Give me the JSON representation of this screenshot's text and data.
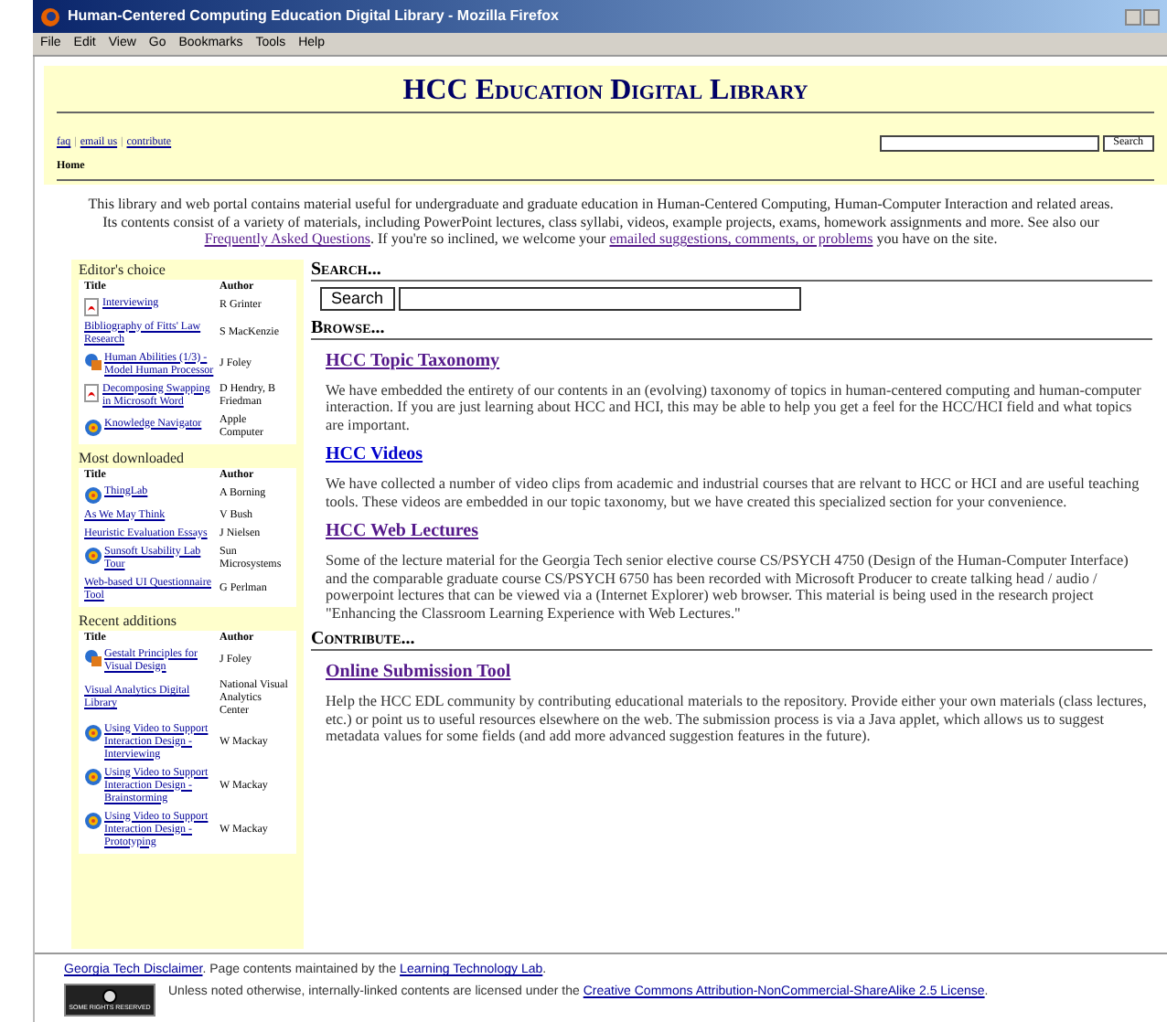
{
  "window": {
    "title": "Human-Centered Computing Education Digital Library - Mozilla Firefox"
  },
  "menu": [
    "File",
    "Edit",
    "View",
    "Go",
    "Bookmarks",
    "Tools",
    "Help"
  ],
  "header": {
    "title": "HCC Education Digital Library",
    "links": [
      {
        "kind": "link",
        "text": "faq"
      },
      {
        "kind": "separator",
        "text": "|"
      },
      {
        "kind": "link",
        "text": "email us"
      },
      {
        "kind": "separator",
        "text": "|"
      },
      {
        "kind": "link",
        "text": "contribute"
      }
    ],
    "search_button": "Search",
    "breadcrumb": "Home"
  },
  "intro": [
    {
      "kind": "text",
      "text": "This library and web portal contains material useful for undergraduate and graduate education in Human-Centered Computing, Human-Computer Interaction and related areas. Its contents consist of a variety of materials, including PowerPoint lectures, class syllabi, videos, example projects, exams, homework assignments and more. See also our "
    },
    {
      "kind": "link",
      "text": "Frequently Asked Questions"
    },
    {
      "kind": "text",
      "text": ". If you're so inclined, we welcome your "
    },
    {
      "kind": "link",
      "text": "emailed suggestions, comments, or problems"
    },
    {
      "kind": "text",
      "text": " you have on the site."
    }
  ],
  "sidebar": [
    {
      "title": "Editor's choice",
      "columns": [
        "Title",
        "Author"
      ],
      "items": [
        {
          "title": "Interviewing",
          "author": "R Grinter",
          "kind": "pdf"
        },
        {
          "title": "Bibliography of Fitts' Law Research",
          "author": "S MacKenzie",
          "kind": "none"
        },
        {
          "title": "Human Abilities (1/3) - Model Human Processor",
          "author": "J Foley",
          "kind": "slides"
        },
        {
          "title": "Decomposing Swapping in Microsoft Word",
          "author": "D Hendry, B Friedman",
          "kind": "pdf"
        },
        {
          "title": "Knowledge Navigator",
          "author": "Apple Computer",
          "kind": "video"
        }
      ]
    },
    {
      "title": "Most downloaded",
      "columns": [
        "Title",
        "Author"
      ],
      "items": [
        {
          "title": "ThingLab",
          "author": "A Borning",
          "kind": "video"
        },
        {
          "title": "As We May Think",
          "author": "V Bush",
          "kind": "none"
        },
        {
          "title": "Heuristic Evaluation Essays",
          "author": "J Nielsen",
          "kind": "none"
        },
        {
          "title": "Sunsoft Usability Lab Tour",
          "author": "Sun Microsystems",
          "kind": "video"
        },
        {
          "title": "Web-based UI Questionnaire Tool",
          "author": "G Perlman",
          "kind": "none"
        }
      ]
    },
    {
      "title": "Recent additions",
      "columns": [
        "Title",
        "Author"
      ],
      "items": [
        {
          "title": "Gestalt Principles for Visual Design",
          "author": "J Foley",
          "kind": "slides"
        },
        {
          "title": "Visual Analytics Digital Library",
          "author": "National Visual Analytics Center",
          "kind": "none"
        },
        {
          "title": "Using Video to Support Interaction Design - Interviewing",
          "author": "W Mackay",
          "kind": "video"
        },
        {
          "title": "Using Video to Support Interaction Design - Brainstorming",
          "author": "W Mackay",
          "kind": "video"
        },
        {
          "title": "Using Video to Support Interaction Design - Prototyping",
          "author": "W Mackay",
          "kind": "video"
        }
      ]
    }
  ],
  "search": {
    "heading": "Search...",
    "button": "Search"
  },
  "browse": {
    "heading": "Browse...",
    "entries": [
      {
        "title": "HCC Topic Taxonomy",
        "visited": true,
        "text": "We have embedded the entirety of our contents in an (evolving) taxonomy of topics in human-centered computing and human-computer interaction. If you are just learning about HCC and HCI, this may be able to help you get a feel for the HCC/HCI field and what topics are important."
      },
      {
        "title": "HCC Videos",
        "visited": false,
        "text": "We have collected a number of video clips from academic and industrial courses that are relvant to HCC or HCI and are useful teaching tools. These videos are embedded in our topic taxonomy, but we have created this specialized section for your convenience."
      },
      {
        "title": "HCC Web Lectures",
        "visited": true,
        "text": "Some of the lecture material for the Georgia Tech senior elective course CS/PSYCH 4750 (Design of the Human-Computer Interface) and the comparable graduate course CS/PSYCH 6750 has been recorded with Microsoft Producer to create talking head / audio / powerpoint lectures that can be viewed via a (Internet Explorer) web browser. This material is being used in the research project \"Enhancing the Classroom Learning Experience with Web Lectures.\""
      }
    ]
  },
  "contribute": {
    "heading": "Contribute...",
    "entries": [
      {
        "title": "Online Submission Tool",
        "visited": true,
        "text": "Help the HCC EDL community by contributing educational materials to the repository. Provide either your own materials (class lectures, etc.) or point us to useful resources elsewhere on the web. The submission process is via a Java applet, which allows us to suggest metadata values for some fields (and add more advanced suggestion features in the future)."
      }
    ]
  },
  "footer": {
    "line1": [
      {
        "kind": "link",
        "text": "Georgia Tech Disclaimer"
      },
      {
        "kind": "text",
        "text": ". Page contents maintained by the "
      },
      {
        "kind": "link",
        "text": "Learning Technology Lab"
      },
      {
        "kind": "text",
        "text": "."
      }
    ],
    "badge": "SOME RIGHTS RESERVED",
    "line2": [
      {
        "kind": "text",
        "text": "Unless noted otherwise, internally-linked contents are licensed under the "
      },
      {
        "kind": "link",
        "text": "Creative Commons Attribution-NonCommercial-ShareAlike 2.5 License"
      },
      {
        "kind": "text",
        "text": "."
      }
    ]
  }
}
